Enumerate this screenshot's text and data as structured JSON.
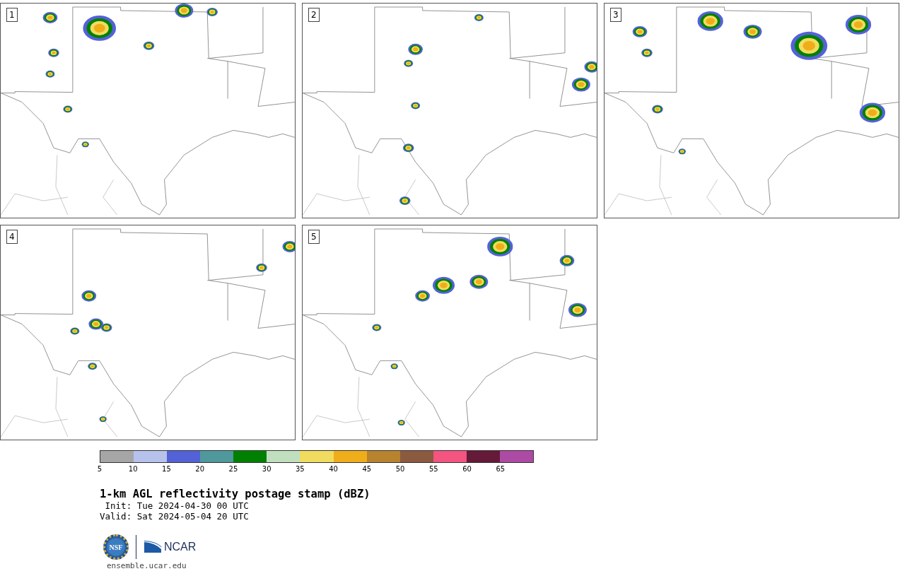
{
  "panels": [
    {
      "label": "1"
    },
    {
      "label": "2"
    },
    {
      "label": "3"
    },
    {
      "label": "4"
    },
    {
      "label": "5"
    }
  ],
  "colorbar": {
    "segments": [
      {
        "color": "#a6a6a6"
      },
      {
        "color": "#b7c2ec"
      },
      {
        "color": "#5462d8"
      },
      {
        "color": "#4f989c"
      },
      {
        "color": "#008000"
      },
      {
        "color": "#c0dfbe"
      },
      {
        "color": "#f0dc5e"
      },
      {
        "color": "#f0ad1a"
      },
      {
        "color": "#b8832e"
      },
      {
        "color": "#8c5a3e"
      },
      {
        "color": "#f35480"
      },
      {
        "color": "#641a38"
      },
      {
        "color": "#ad4aa4"
      }
    ],
    "ticks": [
      "5",
      "10",
      "15",
      "20",
      "25",
      "30",
      "35",
      "40",
      "45",
      "50",
      "55",
      "60",
      "65"
    ]
  },
  "title": "1-km AGL reflectivity postage stamp (dBZ)",
  "init": " Init: Tue 2024-04-30 00 UTC",
  "valid": "Valid: Sat 2024-05-04 20 UTC",
  "logos": {
    "nsf": "NSF",
    "ncar": "NCAR"
  },
  "url": "ensemble.ucar.edu"
}
